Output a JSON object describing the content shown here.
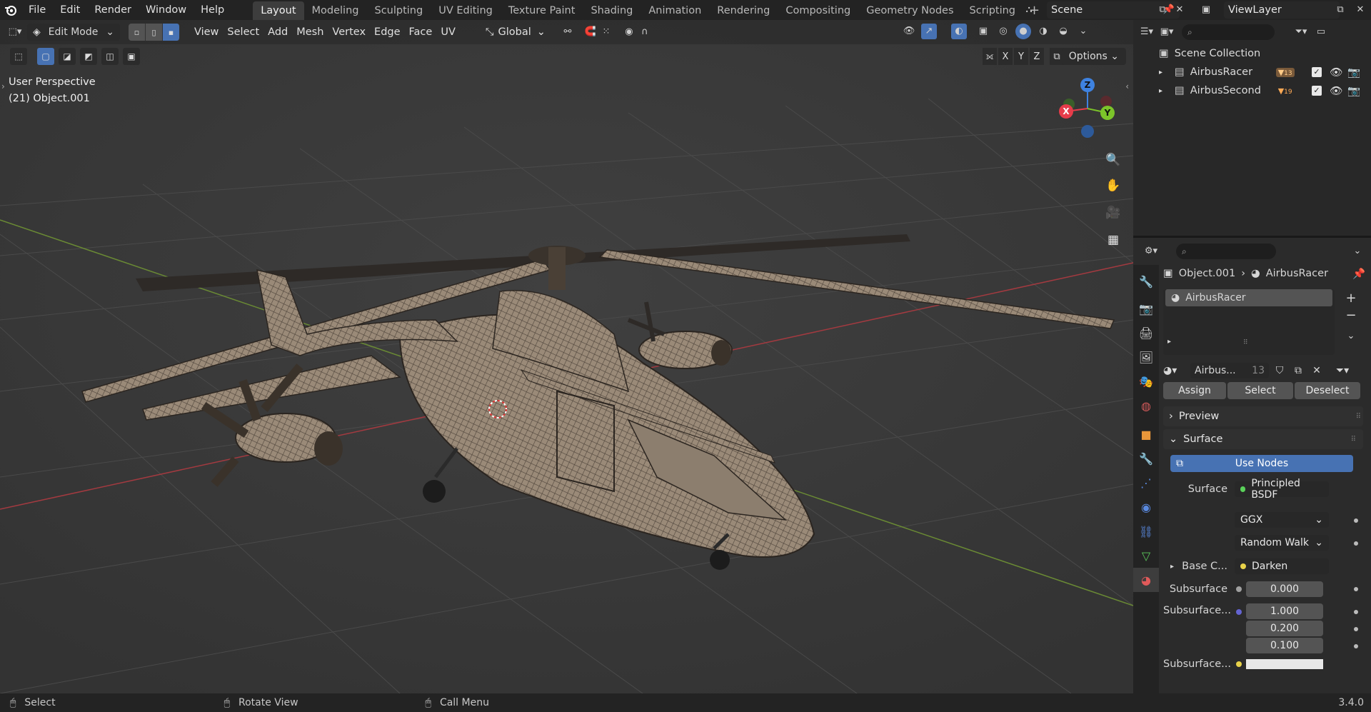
{
  "app": {
    "menus": [
      "File",
      "Edit",
      "Render",
      "Window",
      "Help"
    ],
    "workspaces": [
      "Layout",
      "Modeling",
      "Sculpting",
      "UV Editing",
      "Texture Paint",
      "Shading",
      "Animation",
      "Rendering",
      "Compositing",
      "Geometry Nodes",
      "Scripting"
    ],
    "add_tab": "+",
    "scene": "Scene",
    "view_layer": "ViewLayer"
  },
  "viewport": {
    "mode": "Edit Mode",
    "menus": [
      "View",
      "Select",
      "Add",
      "Mesh",
      "Vertex",
      "Edge",
      "Face",
      "UV"
    ],
    "transform_orientation": "Global",
    "perspective": "User Perspective",
    "object": "(21) Object.001",
    "options": "Options",
    "axis_x": "X",
    "axis_y": "Y",
    "axis_z": "Z",
    "gizmo": {
      "x": "X",
      "y": "Y",
      "z": "Z"
    }
  },
  "outliner": {
    "root": "Scene Collection",
    "items": [
      {
        "name": "AirbusRacer",
        "count": "13"
      },
      {
        "name": "AirbusSecond",
        "count": "19"
      }
    ]
  },
  "properties": {
    "breadcrumb_object": "Object.001",
    "breadcrumb_material": "AirbusRacer",
    "slot_name": "AirbusRacer",
    "material_name": "Airbus...",
    "material_users": "13",
    "assign": "Assign",
    "select": "Select",
    "deselect": "Deselect",
    "preview": "Preview",
    "surface_panel": "Surface",
    "use_nodes": "Use Nodes",
    "surface_label": "Surface",
    "surface_value": "Principled BSDF",
    "distribution": "GGX",
    "subsurface_method": "Random Walk",
    "base_color_label": "Base C...",
    "base_color_value": "Darken",
    "subsurface_label": "Subsurface",
    "subsurface_value": "0.000",
    "subsurface_radius_label": "Subsurface...",
    "radius_values": [
      "1.000",
      "0.200",
      "0.100"
    ],
    "subsurface_color_label": "Subsurface..."
  },
  "status": {
    "select": "Select",
    "rotate": "Rotate View",
    "menu": "Call Menu",
    "version": "3.4.0"
  },
  "colors": {
    "accent": "#4772b3",
    "axis_x": "#e63c4a",
    "axis_y": "#7cc42a",
    "axis_z": "#3e82e0"
  }
}
